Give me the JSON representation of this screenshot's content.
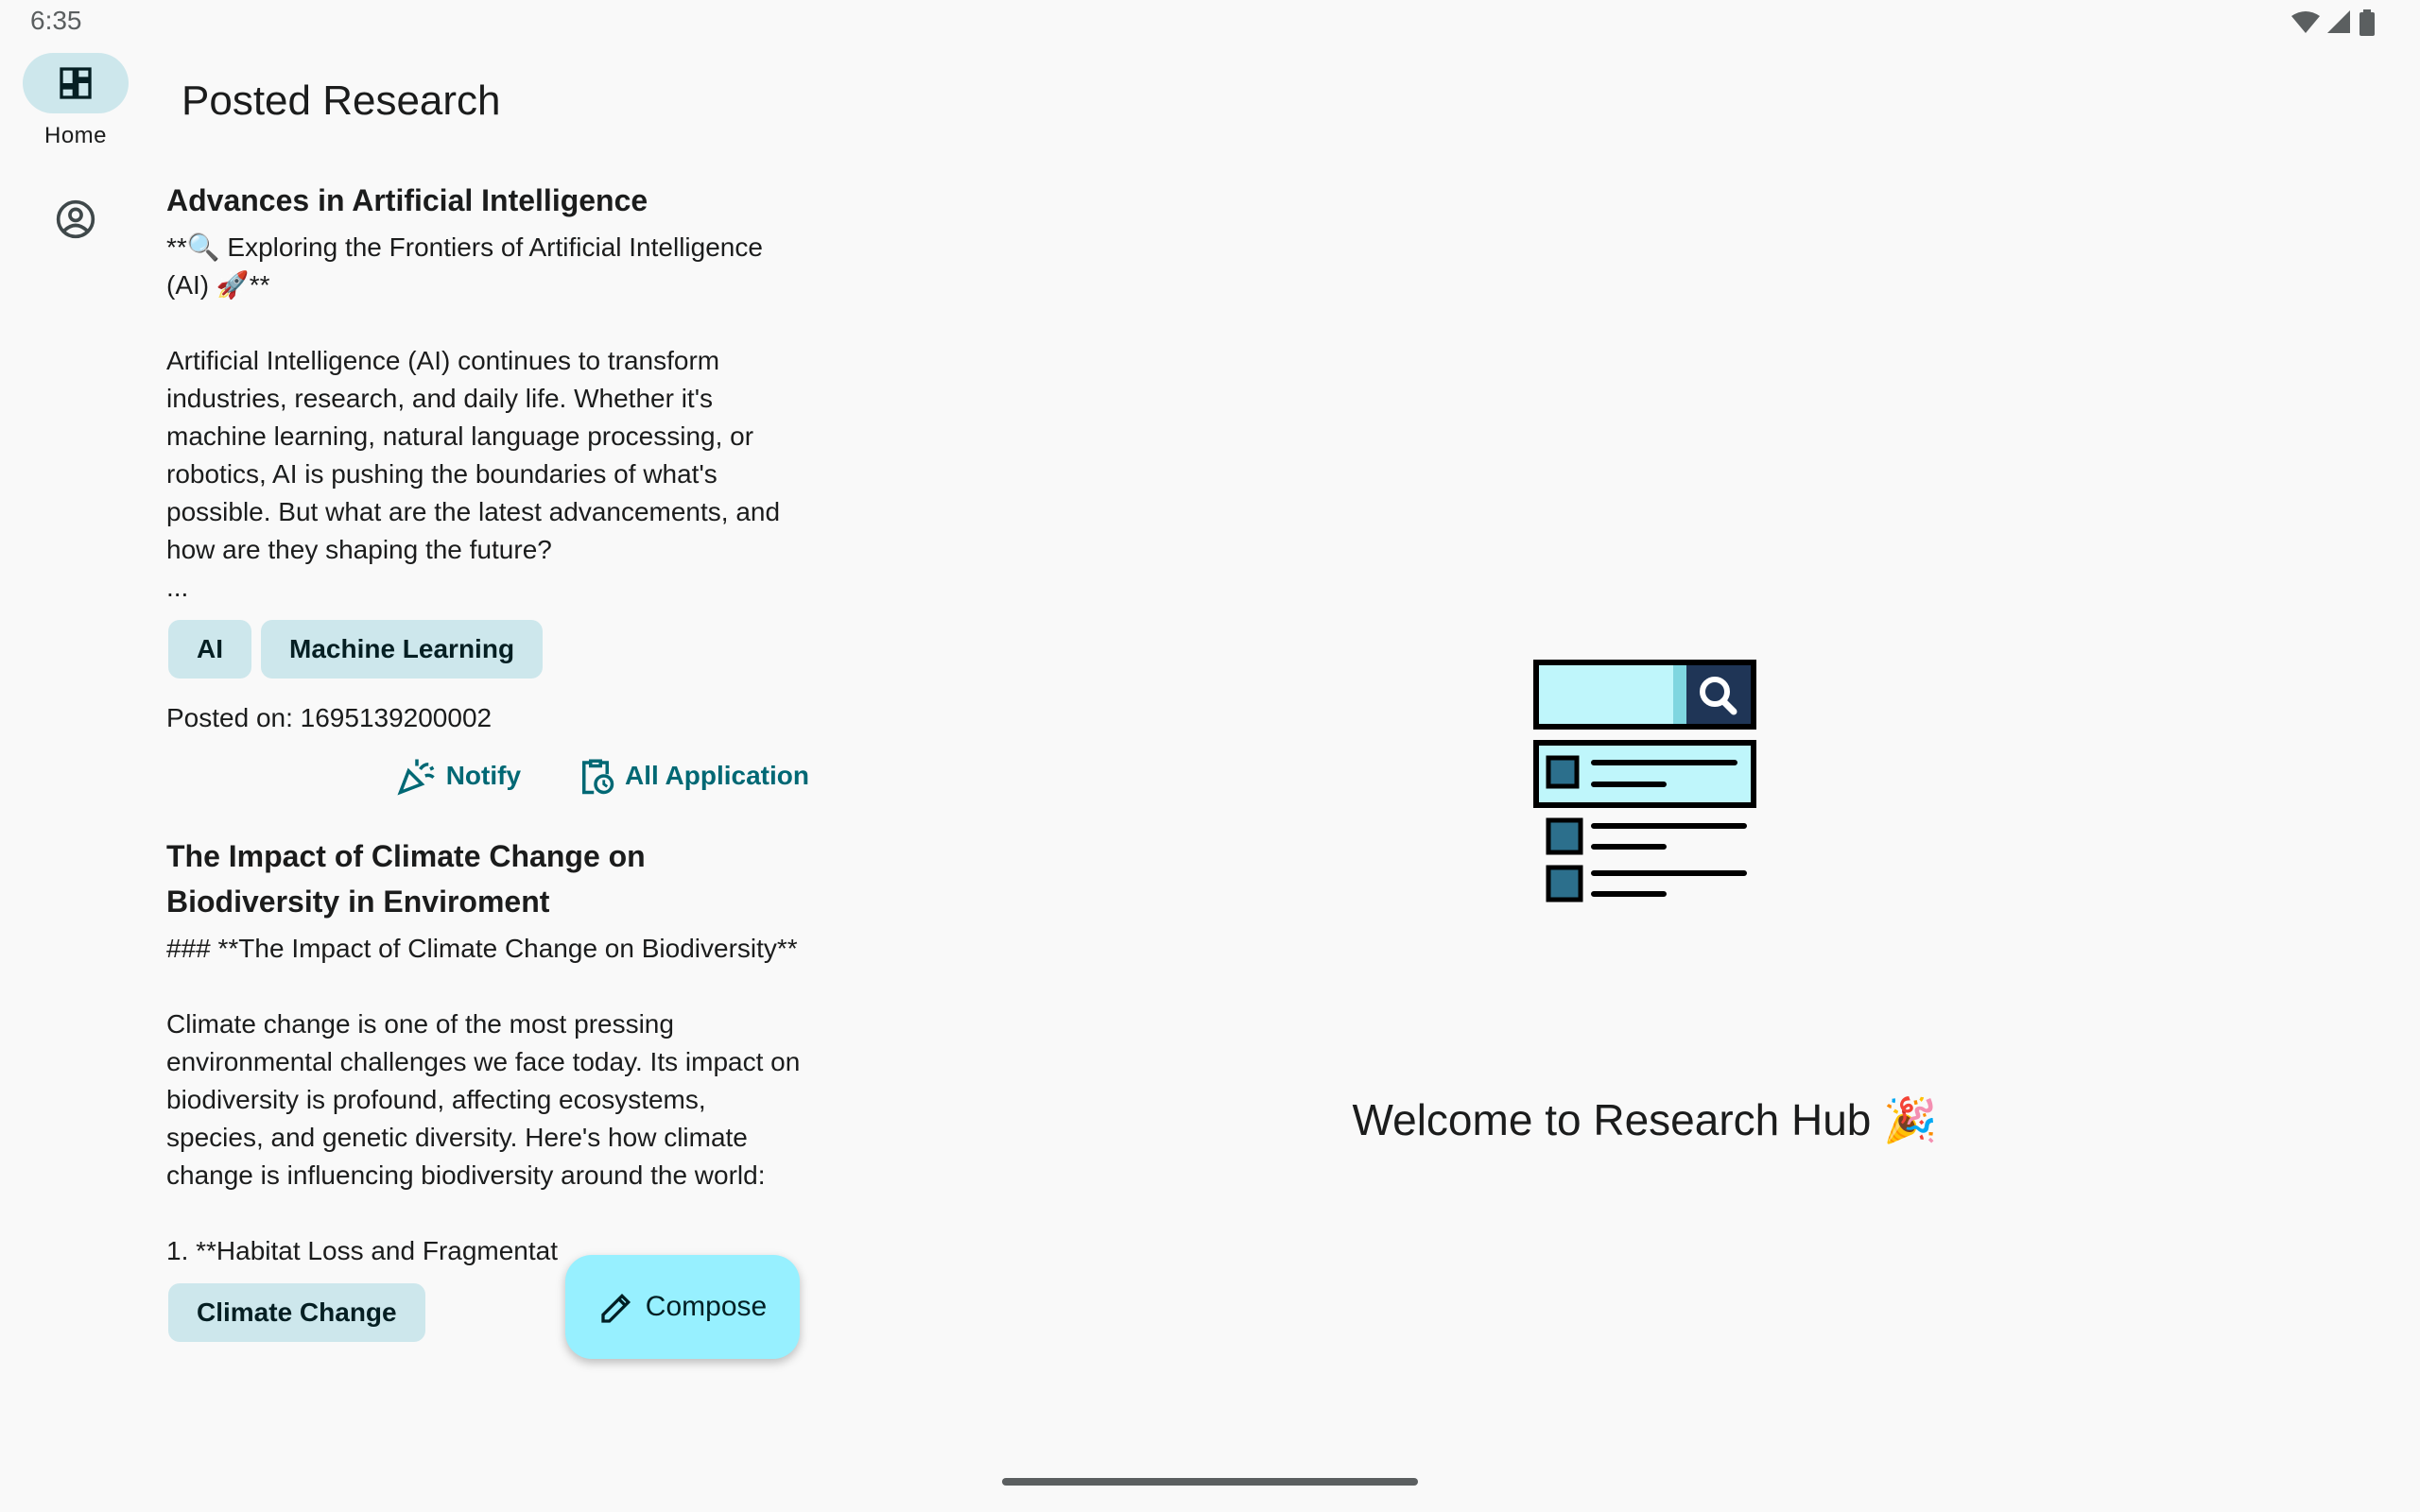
{
  "status": {
    "time": "6:35"
  },
  "nav": {
    "items": [
      {
        "label": "Home",
        "icon": "dashboard-icon",
        "active": true
      },
      {
        "label": "",
        "icon": "account-circle-icon",
        "active": false
      }
    ]
  },
  "page": {
    "title": "Posted Research"
  },
  "posts": [
    {
      "title": "Advances in Artificial Intelligence",
      "body": "**🔍 Exploring the Frontiers of Artificial Intelligence (AI) 🚀**\n\nArtificial Intelligence (AI) continues to transform industries, research, and daily life. Whether it's machine learning, natural language processing, or robotics, AI is pushing the boundaries of what's possible. But what are the latest advancements, and how are they shaping the future?\n...",
      "tags": [
        "AI",
        "Machine Learning"
      ],
      "posted_on": "Posted on: 1695139200002",
      "notify_label": "Notify",
      "applications_label": "All Application"
    },
    {
      "title": "The Impact of Climate Change on Biodiversity in Enviroment",
      "body": "### **The Impact of Climate Change on Biodiversity**\n\nClimate change is one of the most pressing environmental challenges we face today. Its impact on biodiversity is profound, affecting ecosystems, species, and genetic diversity. Here's how climate change is influencing biodiversity around the world:\n\n1. **Habitat Loss and Fragmentat",
      "tags": [
        "Climate Change"
      ]
    }
  ],
  "fab": {
    "label": "Compose"
  },
  "detail": {
    "welcome": "Welcome to Research Hub 🎉"
  },
  "colors": {
    "background": "#f9f9f9",
    "chip": "#cde7ec",
    "accent": "#006874",
    "fab": "#97f0ff"
  }
}
